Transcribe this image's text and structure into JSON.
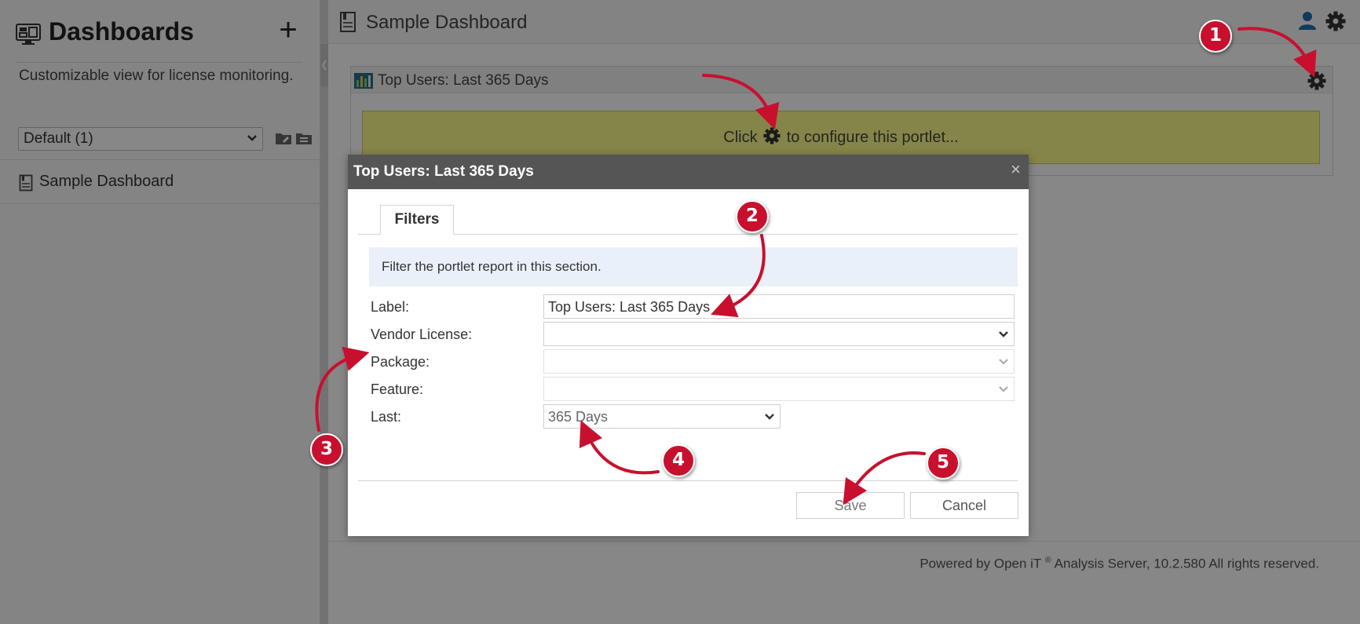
{
  "sidebar": {
    "title": "Dashboards",
    "add_label": "+",
    "description": "Customizable view for license monitoring.",
    "dashboard_select_value": "Default (1)",
    "items": [
      {
        "label": "Sample Dashboard",
        "icon": "document-icon"
      }
    ]
  },
  "header": {
    "title": "Sample Dashboard",
    "icons": [
      "user-icon",
      "gear-icon"
    ]
  },
  "portlet": {
    "title": "Top Users: Last 365 Days",
    "message_pre": "Click",
    "message_post": "to configure this portlet..."
  },
  "dialog": {
    "title": "Top Users: Last 365 Days",
    "close_label": "×",
    "tabs": [
      {
        "label": "Filters"
      }
    ],
    "info": "Filter the portlet report in this section.",
    "fields": {
      "label": {
        "label": "Label:",
        "value": "Top Users: Last 365 Days"
      },
      "vendor_license": {
        "label": "Vendor License:",
        "value": ""
      },
      "package": {
        "label": "Package:",
        "value": ""
      },
      "feature": {
        "label": "Feature:",
        "value": ""
      },
      "last": {
        "label": "Last:",
        "value": "365 Days"
      }
    },
    "buttons": {
      "save": "Save",
      "cancel": "Cancel"
    }
  },
  "footer": {
    "pre": "Powered by Open iT",
    "sup": "®",
    "post": "Analysis Server, 10.2.580 All rights reserved."
  },
  "callouts": [
    "1",
    "2",
    "3",
    "4",
    "5"
  ],
  "colors": {
    "callout_red": "#c8102e",
    "dialog_header": "#555555",
    "portlet_message_bg": "#fcfc8a",
    "info_box_bg": "#eaf0fa",
    "user_icon": "#1f6fb2"
  }
}
